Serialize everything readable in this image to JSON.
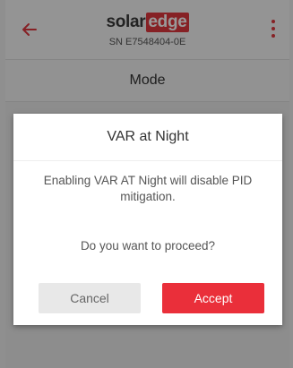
{
  "header": {
    "logo_solar": "solar",
    "logo_edge": "edge",
    "serial": "SN E7548404-0E"
  },
  "mode_bar": {
    "title": "Mode"
  },
  "dialog": {
    "title": "VAR at Night",
    "message": "Enabling VAR AT Night will disable PID mitigation.",
    "question": "Do you want to proceed?",
    "cancel_label": "Cancel",
    "accept_label": "Accept"
  },
  "colors": {
    "brand_red": "#e0383e",
    "accept_button": "#ea2f3a",
    "cancel_button": "#e8e8e8"
  },
  "icons": {
    "back": "arrow-left-icon",
    "menu": "more-vertical-icon"
  }
}
